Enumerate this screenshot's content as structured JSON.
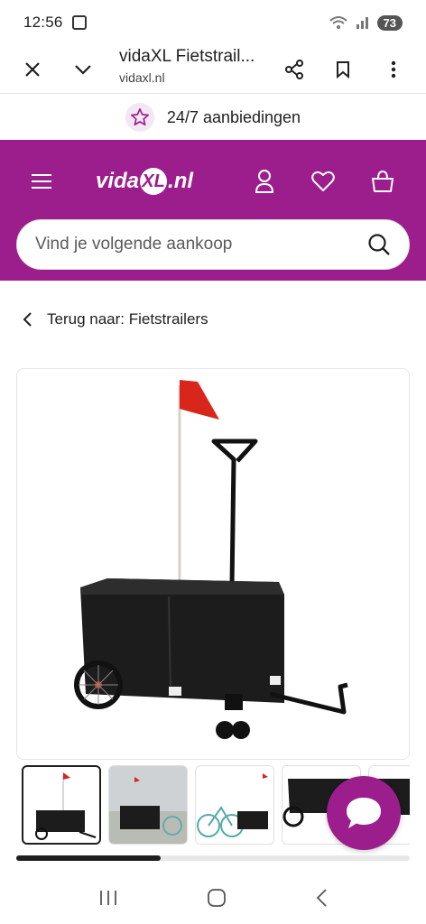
{
  "status_bar": {
    "time": "12:56",
    "battery": "73"
  },
  "browser": {
    "title": "vidaXL Fietstrail...",
    "domain": "vidaxl.nl"
  },
  "promo": {
    "text": "24/7 aanbiedingen"
  },
  "brand": {
    "logo_pre": "vida",
    "logo_xl": "XL",
    "logo_post": ".nl",
    "accent": "#9c1e8c"
  },
  "search": {
    "placeholder": "Vind je volgende aankoop"
  },
  "breadcrumb": {
    "back_label": "Terug naar: Fietstrailers"
  },
  "gallery": {
    "thumbnail_count": 5,
    "active_index": 0
  }
}
